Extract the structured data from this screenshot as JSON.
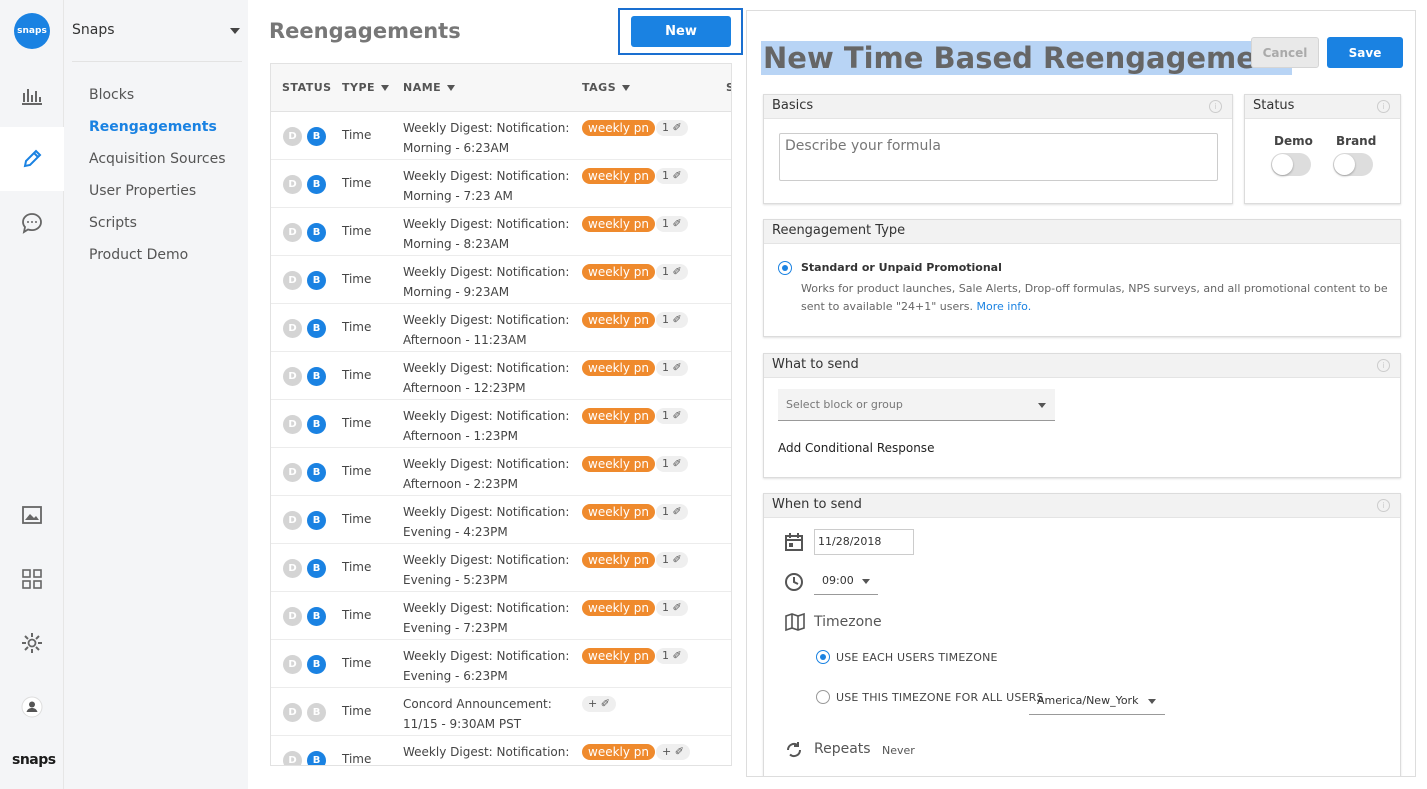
{
  "app": {
    "org": "Snaps",
    "logo_text": "snaps",
    "brand_text": "snaps"
  },
  "rail_icons": [
    "bar-chart-icon",
    "pencil-icon",
    "chat-bubble-icon",
    "image-icon",
    "grid-icon",
    "gear-icon",
    "user-icon"
  ],
  "subnav": {
    "items": [
      {
        "label": "Blocks",
        "active": false
      },
      {
        "label": "Reengagements",
        "active": true
      },
      {
        "label": "Acquisition Sources",
        "active": false
      },
      {
        "label": "User Properties",
        "active": false
      },
      {
        "label": "Scripts",
        "active": false
      },
      {
        "label": "Product Demo",
        "active": false
      }
    ]
  },
  "list": {
    "title": "Reengagements",
    "new_label": "New",
    "columns": [
      "STATUS",
      "TYPE",
      "NAME",
      "TAGS",
      "S"
    ],
    "rows": [
      {
        "d": "D",
        "b": "B",
        "b_active": true,
        "type": "Time",
        "name": "Weekly Digest: Notification: Morning - 6:23AM",
        "tag": "weekly pn",
        "count": "1"
      },
      {
        "d": "D",
        "b": "B",
        "b_active": true,
        "type": "Time",
        "name": "Weekly Digest: Notification: Morning - 7:23 AM",
        "tag": "weekly pn",
        "count": "1"
      },
      {
        "d": "D",
        "b": "B",
        "b_active": true,
        "type": "Time",
        "name": "Weekly Digest: Notification: Morning - 8:23AM",
        "tag": "weekly pn",
        "count": "1"
      },
      {
        "d": "D",
        "b": "B",
        "b_active": true,
        "type": "Time",
        "name": "Weekly Digest: Notification: Morning - 9:23AM",
        "tag": "weekly pn",
        "count": "1"
      },
      {
        "d": "D",
        "b": "B",
        "b_active": true,
        "type": "Time",
        "name": "Weekly Digest: Notification: Afternoon - 11:23AM",
        "tag": "weekly pn",
        "count": "1"
      },
      {
        "d": "D",
        "b": "B",
        "b_active": true,
        "type": "Time",
        "name": "Weekly Digest: Notification: Afternoon - 12:23PM",
        "tag": "weekly pn",
        "count": "1"
      },
      {
        "d": "D",
        "b": "B",
        "b_active": true,
        "type": "Time",
        "name": "Weekly Digest: Notification: Afternoon - 1:23PM",
        "tag": "weekly pn",
        "count": "1"
      },
      {
        "d": "D",
        "b": "B",
        "b_active": true,
        "type": "Time",
        "name": "Weekly Digest: Notification: Afternoon - 2:23PM",
        "tag": "weekly pn",
        "count": "1"
      },
      {
        "d": "D",
        "b": "B",
        "b_active": true,
        "type": "Time",
        "name": "Weekly Digest: Notification: Evening - 4:23PM",
        "tag": "weekly pn",
        "count": "1"
      },
      {
        "d": "D",
        "b": "B",
        "b_active": true,
        "type": "Time",
        "name": "Weekly Digest: Notification: Evening - 5:23PM",
        "tag": "weekly pn",
        "count": "1"
      },
      {
        "d": "D",
        "b": "B",
        "b_active": true,
        "type": "Time",
        "name": "Weekly Digest: Notification: Evening - 7:23PM",
        "tag": "weekly pn",
        "count": "1"
      },
      {
        "d": "D",
        "b": "B",
        "b_active": true,
        "type": "Time",
        "name": "Weekly Digest: Notification: Evening - 6:23PM",
        "tag": "weekly pn",
        "count": "1"
      },
      {
        "d": "D",
        "b": "B",
        "b_active": false,
        "type": "Time",
        "name": "Concord Announcement: 11/15 - 9:30AM PST",
        "tag": "",
        "count": "+"
      },
      {
        "d": "D",
        "b": "B",
        "b_active": true,
        "type": "Time",
        "name": "Weekly Digest: Notification:",
        "tag": "weekly pn",
        "count": "+"
      }
    ]
  },
  "panel": {
    "title": "New Time Based Reengagement",
    "cancel_label": "Cancel",
    "save_label": "Save",
    "basics": {
      "header": "Basics",
      "placeholder": "Describe your formula"
    },
    "status": {
      "header": "Status",
      "demo_label": "Demo",
      "brand_label": "Brand",
      "demo_on": false,
      "brand_on": false
    },
    "type": {
      "header": "Reengagement Type",
      "option_title": "Standard or Unpaid Promotional",
      "option_desc": "Works for product launches, Sale Alerts, Drop-off formulas, NPS surveys,  and all promotional content to be sent to available \"24+1\" users.",
      "more_info": "More info."
    },
    "what": {
      "header": "What to send",
      "select_placeholder": "Select block or group",
      "add_conditional": "Add Conditional Response"
    },
    "when": {
      "header": "When to send",
      "date": "11/28/2018",
      "time": "09:00",
      "timezone_label": "Timezone",
      "opt_each": "USE EACH USERS TIMEZONE",
      "opt_this": "USE THIS TIMEZONE FOR ALL USERS",
      "tz_value": "America/New_York",
      "repeats_label": "Repeats",
      "repeats_value": "Never"
    }
  },
  "colors": {
    "accent": "#1a82e2",
    "tag": "#ef8a2d",
    "highlight": "#b8d4f5"
  }
}
